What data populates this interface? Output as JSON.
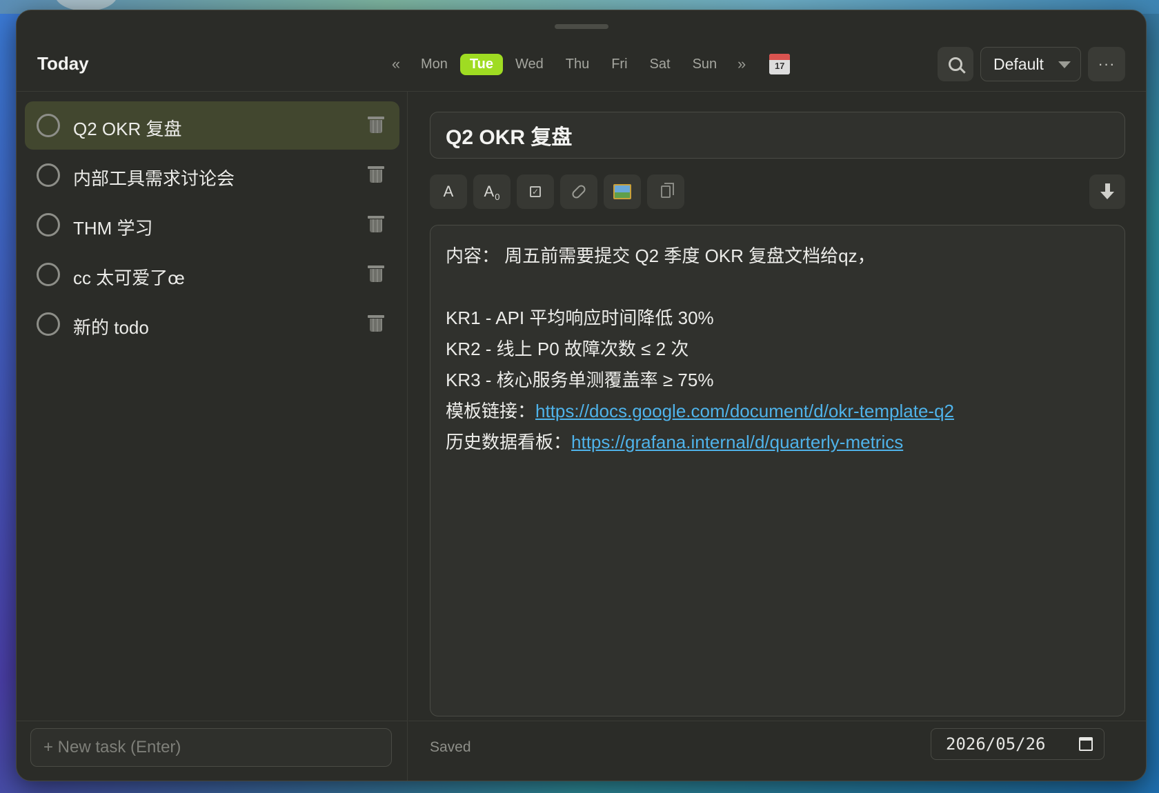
{
  "header": {
    "title": "Today",
    "prev_week": "«",
    "next_week": "»",
    "days": [
      "Mon",
      "Tue",
      "Wed",
      "Thu",
      "Fri",
      "Sat",
      "Sun"
    ],
    "active_day": "Tue",
    "calendar_day": "17",
    "profile": "Default",
    "more": "···",
    "accent_color": "#9fdc22"
  },
  "tasks": [
    {
      "label": "Q2 OKR 复盘",
      "selected": true
    },
    {
      "label": "内部工具需求讨论会",
      "selected": false
    },
    {
      "label": "THM 学习",
      "selected": false
    },
    {
      "label": "cc 太可爱了œ",
      "selected": false
    },
    {
      "label": "新的 todo",
      "selected": false
    }
  ],
  "new_task": {
    "placeholder": "+ New task (Enter)"
  },
  "editor": {
    "title": "Q2 OKR 复盘",
    "toolbar": {
      "font": "A",
      "size_main": "A",
      "size_sub": "0",
      "checkbox": "✓"
    },
    "content": {
      "line1": "内容： 周五前需要提交 Q2 季度 OKR 复盘文档给qz，",
      "kr1": "KR1 - API 平均响应时间降低 30%",
      "kr2": "KR2 - 线上 P0 故障次数 ≤ 2 次",
      "kr3": "KR3 - 核心服务单测覆盖率 ≥ 75%",
      "template_label": "模板链接：",
      "template_url": "https://docs.google.com/document/d/okr-template-q2 ",
      "dashboard_label": "历史数据看板：",
      "dashboard_url": "https://grafana.internal/d/quarterly-metrics"
    },
    "link_color": "#4fb3ea"
  },
  "footer": {
    "status": "Saved",
    "date": "2026/05/26"
  }
}
